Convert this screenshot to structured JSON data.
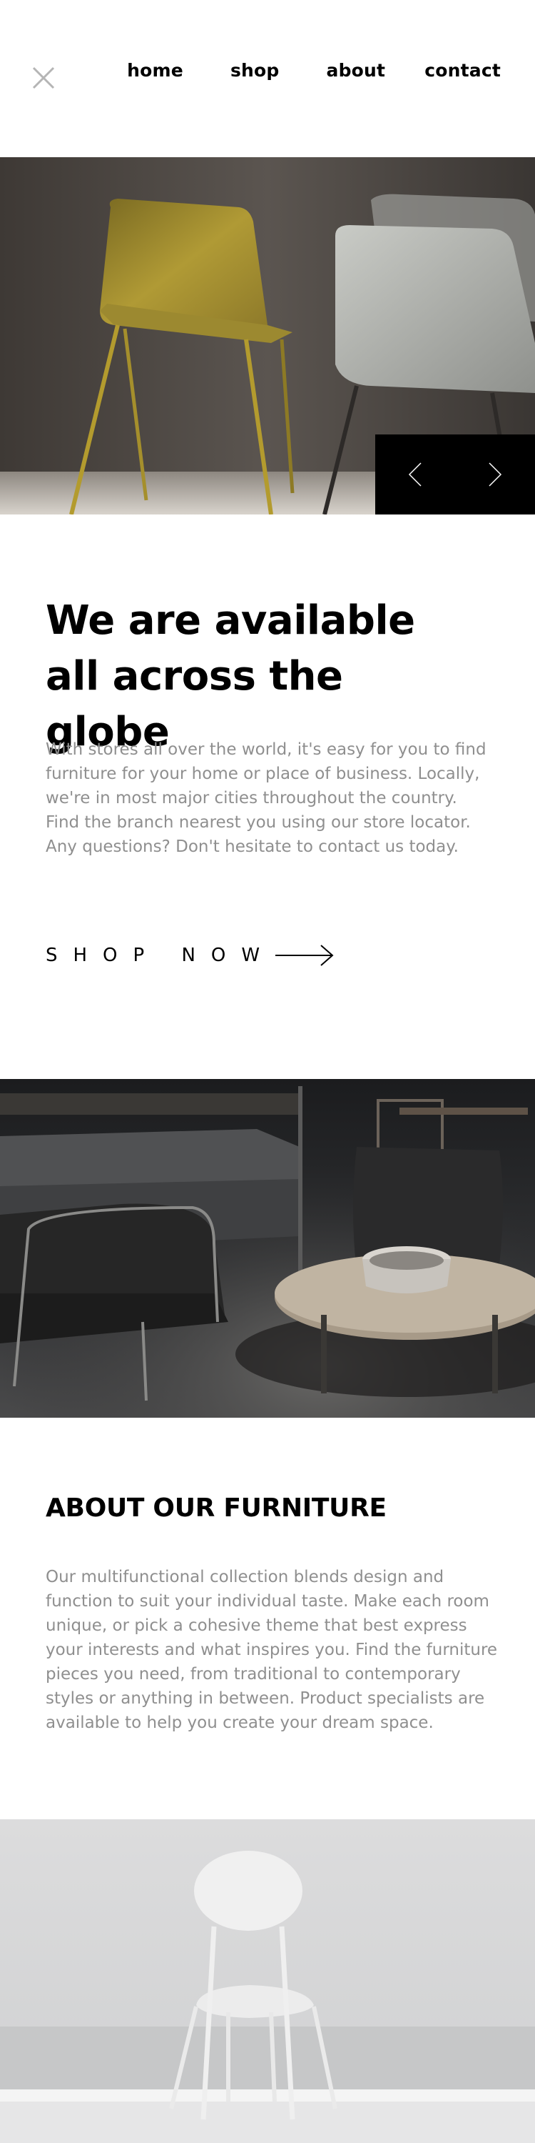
{
  "nav": {
    "items": [
      {
        "label": "home"
      },
      {
        "label": "shop"
      },
      {
        "label": "about"
      },
      {
        "label": "contact"
      }
    ]
  },
  "icons": {
    "close": "close-icon",
    "prev": "chevron-left-icon",
    "next": "chevron-right-icon",
    "arrow": "arrow-right-icon"
  },
  "intro": {
    "title": "We are available all across the globe",
    "text": "With stores all over the world, it's easy for you to find furniture for your home or place of business. Locally, we're in most major cities throughout the country. Find the branch nearest you using our store locator. Any questions? Don't hesitate to contact us today.",
    "cta": "SHOP NOW"
  },
  "about": {
    "title": "ABOUT OUR FURNITURE",
    "text": "Our multifunctional collection blends design and function to suit your individual taste. Make each room unique, or pick a cohesive theme that best express your interests and what inspires you. Find the furniture pieces you need, from traditional to contemporary styles or anything in between. Product specialists are available to help you create your dream space."
  },
  "colors": {
    "text": "#000000",
    "muted": "#8f8f8f",
    "background": "#ffffff",
    "control_bg": "#000000"
  }
}
